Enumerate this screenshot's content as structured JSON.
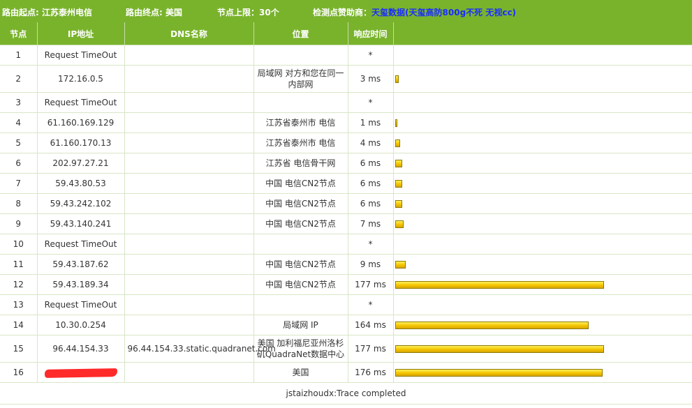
{
  "header": {
    "start": "路由起点: 江苏泰州电信",
    "end": "路由终点: 美国",
    "max_hops": "节点上限：30个",
    "sponsor_label": "检测点赞助商：",
    "sponsor_name": "天玺数据",
    "sponsor_desc": "(天玺高防800g不死 无视cc)"
  },
  "columns": [
    "节点",
    "IP地址",
    "DNS名称",
    "位置",
    "响应时间"
  ],
  "rows": [
    {
      "hop": "1",
      "ip": "Request TimeOut",
      "dns": "",
      "loc": "",
      "rt": "*",
      "ms": null
    },
    {
      "hop": "2",
      "ip": "172.16.0.5",
      "dns": "",
      "loc": "局域网 对方和您在同一内部网",
      "rt": "3 ms",
      "ms": 3
    },
    {
      "hop": "3",
      "ip": "Request TimeOut",
      "dns": "",
      "loc": "",
      "rt": "*",
      "ms": null
    },
    {
      "hop": "4",
      "ip": "61.160.169.129",
      "dns": "",
      "loc": "江苏省泰州市 电信",
      "rt": "1 ms",
      "ms": 1
    },
    {
      "hop": "5",
      "ip": "61.160.170.13",
      "dns": "",
      "loc": "江苏省泰州市 电信",
      "rt": "4 ms",
      "ms": 4
    },
    {
      "hop": "6",
      "ip": "202.97.27.21",
      "dns": "",
      "loc": "江苏省 电信骨干网",
      "rt": "6 ms",
      "ms": 6
    },
    {
      "hop": "7",
      "ip": "59.43.80.53",
      "dns": "",
      "loc": "中国 电信CN2节点",
      "rt": "6 ms",
      "ms": 6
    },
    {
      "hop": "8",
      "ip": "59.43.242.102",
      "dns": "",
      "loc": "中国 电信CN2节点",
      "rt": "6 ms",
      "ms": 6
    },
    {
      "hop": "9",
      "ip": "59.43.140.241",
      "dns": "",
      "loc": "中国 电信CN2节点",
      "rt": "7 ms",
      "ms": 7
    },
    {
      "hop": "10",
      "ip": "Request TimeOut",
      "dns": "",
      "loc": "",
      "rt": "*",
      "ms": null
    },
    {
      "hop": "11",
      "ip": "59.43.187.62",
      "dns": "",
      "loc": "中国 电信CN2节点",
      "rt": "9 ms",
      "ms": 9
    },
    {
      "hop": "12",
      "ip": "59.43.189.34",
      "dns": "",
      "loc": "中国 电信CN2节点",
      "rt": "177 ms",
      "ms": 177
    },
    {
      "hop": "13",
      "ip": "Request TimeOut",
      "dns": "",
      "loc": "",
      "rt": "*",
      "ms": null
    },
    {
      "hop": "14",
      "ip": "10.30.0.254",
      "dns": "",
      "loc": "局域网 IP",
      "rt": "164 ms",
      "ms": 164
    },
    {
      "hop": "15",
      "ip": "96.44.154.33",
      "dns": "96.44.154.33.static.quadranet.com",
      "loc": "美国 加利福尼亚州洛杉矶QuadraNet数据中心",
      "rt": "177 ms",
      "ms": 177
    },
    {
      "hop": "16",
      "ip": "",
      "ip_redacted": true,
      "dns": "",
      "loc": "美国",
      "rt": "176 ms",
      "ms": 176
    }
  ],
  "footer": "jstaizhoudx:Trace completed",
  "colors": {
    "header_bg": "#79b32c",
    "sponsor_link": "#1a2dff",
    "bar_fill": "#f3c400",
    "redaction": "#ff2a2a"
  }
}
